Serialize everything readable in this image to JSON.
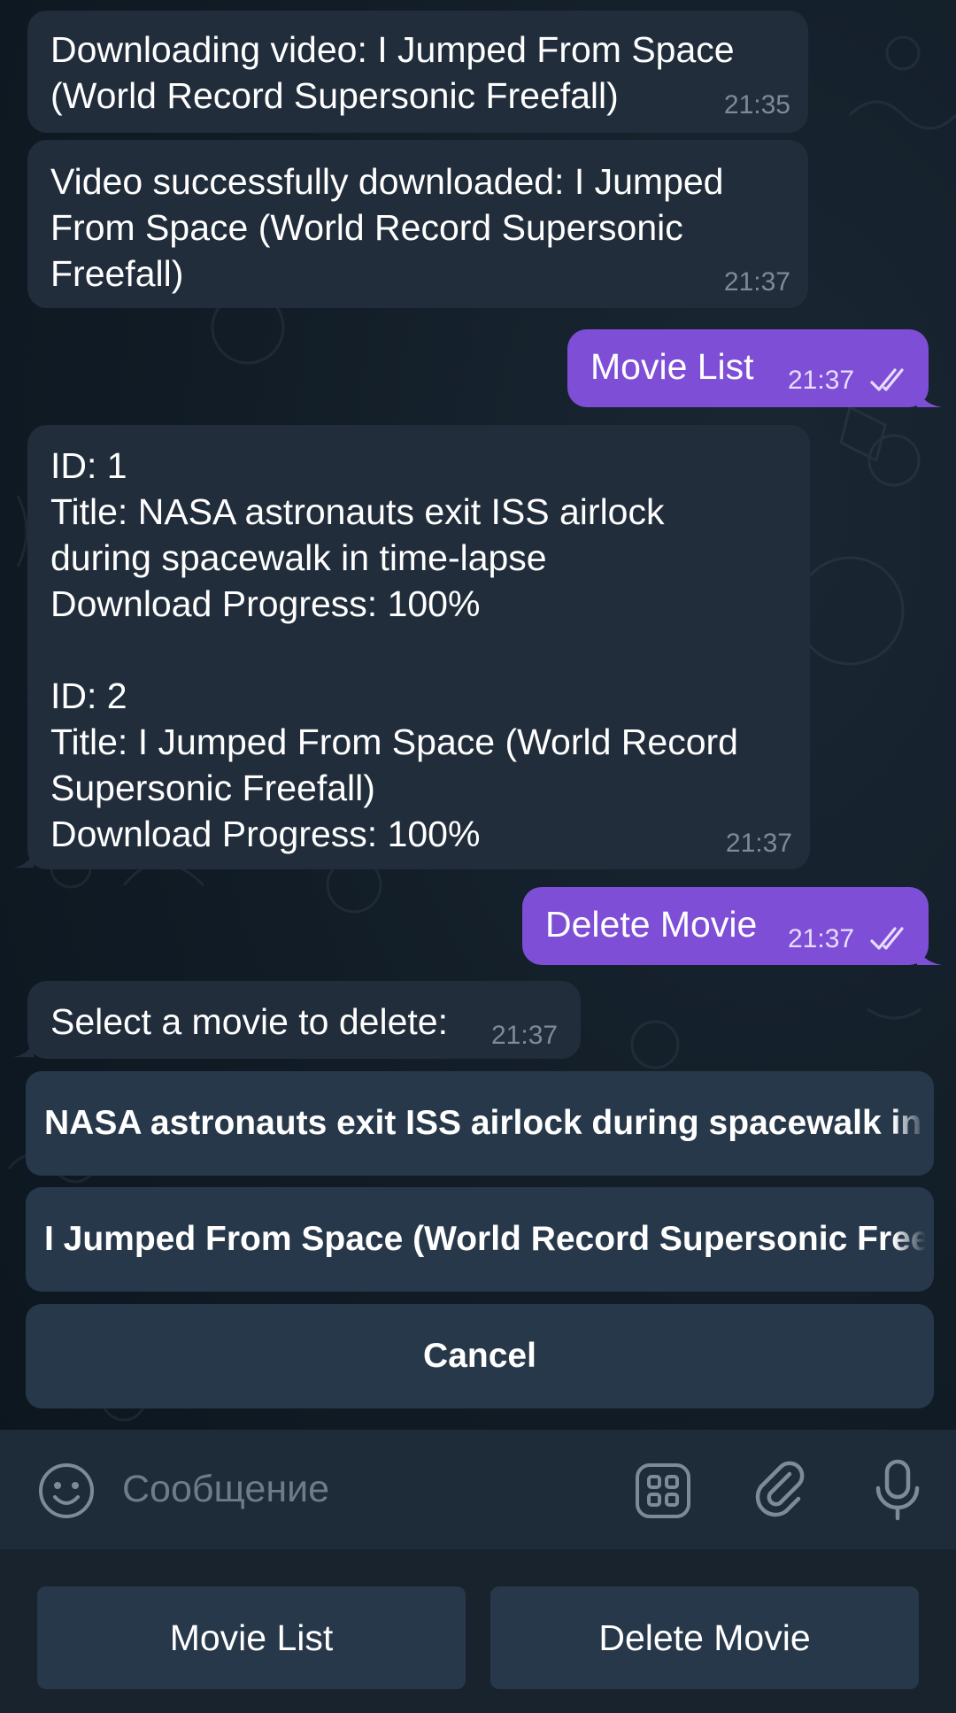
{
  "messages": [
    {
      "text": "Downloading video: I Jumped From Space\n(World Record Supersonic Freefall)",
      "time": "21:35"
    },
    {
      "text": "Video successfully downloaded: I Jumped\nFrom Space (World Record Supersonic\nFreefall)",
      "time": "21:37"
    },
    {
      "text": "Movie List",
      "time": "21:37"
    },
    {
      "text": "ID: 1\nTitle: NASA astronauts exit ISS airlock\nduring spacewalk in time-lapse\nDownload Progress: 100%\n\nID: 2\nTitle: I Jumped From Space (World Record\nSupersonic Freefall)\nDownload Progress: 100%",
      "time": "21:37"
    },
    {
      "text": "Delete Movie",
      "time": "21:37"
    },
    {
      "text": "Select a movie to delete:",
      "time": "21:37"
    }
  ],
  "inline_keyboard": [
    {
      "label": "NASA astronauts exit ISS airlock during spacewalk in time-lapse"
    },
    {
      "label": "I Jumped From Space (World Record Supersonic Freefall)"
    },
    {
      "label": "Cancel"
    }
  ],
  "input": {
    "placeholder": "Сообщение",
    "icons": [
      "emoji-icon",
      "bot-menu-icon",
      "attach-icon",
      "microphone-icon"
    ]
  },
  "reply_keyboard": [
    {
      "label": "Movie List"
    },
    {
      "label": "Delete Movie"
    }
  ],
  "colors": {
    "incoming_bubble": "#212d3b",
    "outgoing_bubble": "#7e4fd6",
    "keyboard_button": "#27384a",
    "input_bar": "#1e2b39"
  }
}
